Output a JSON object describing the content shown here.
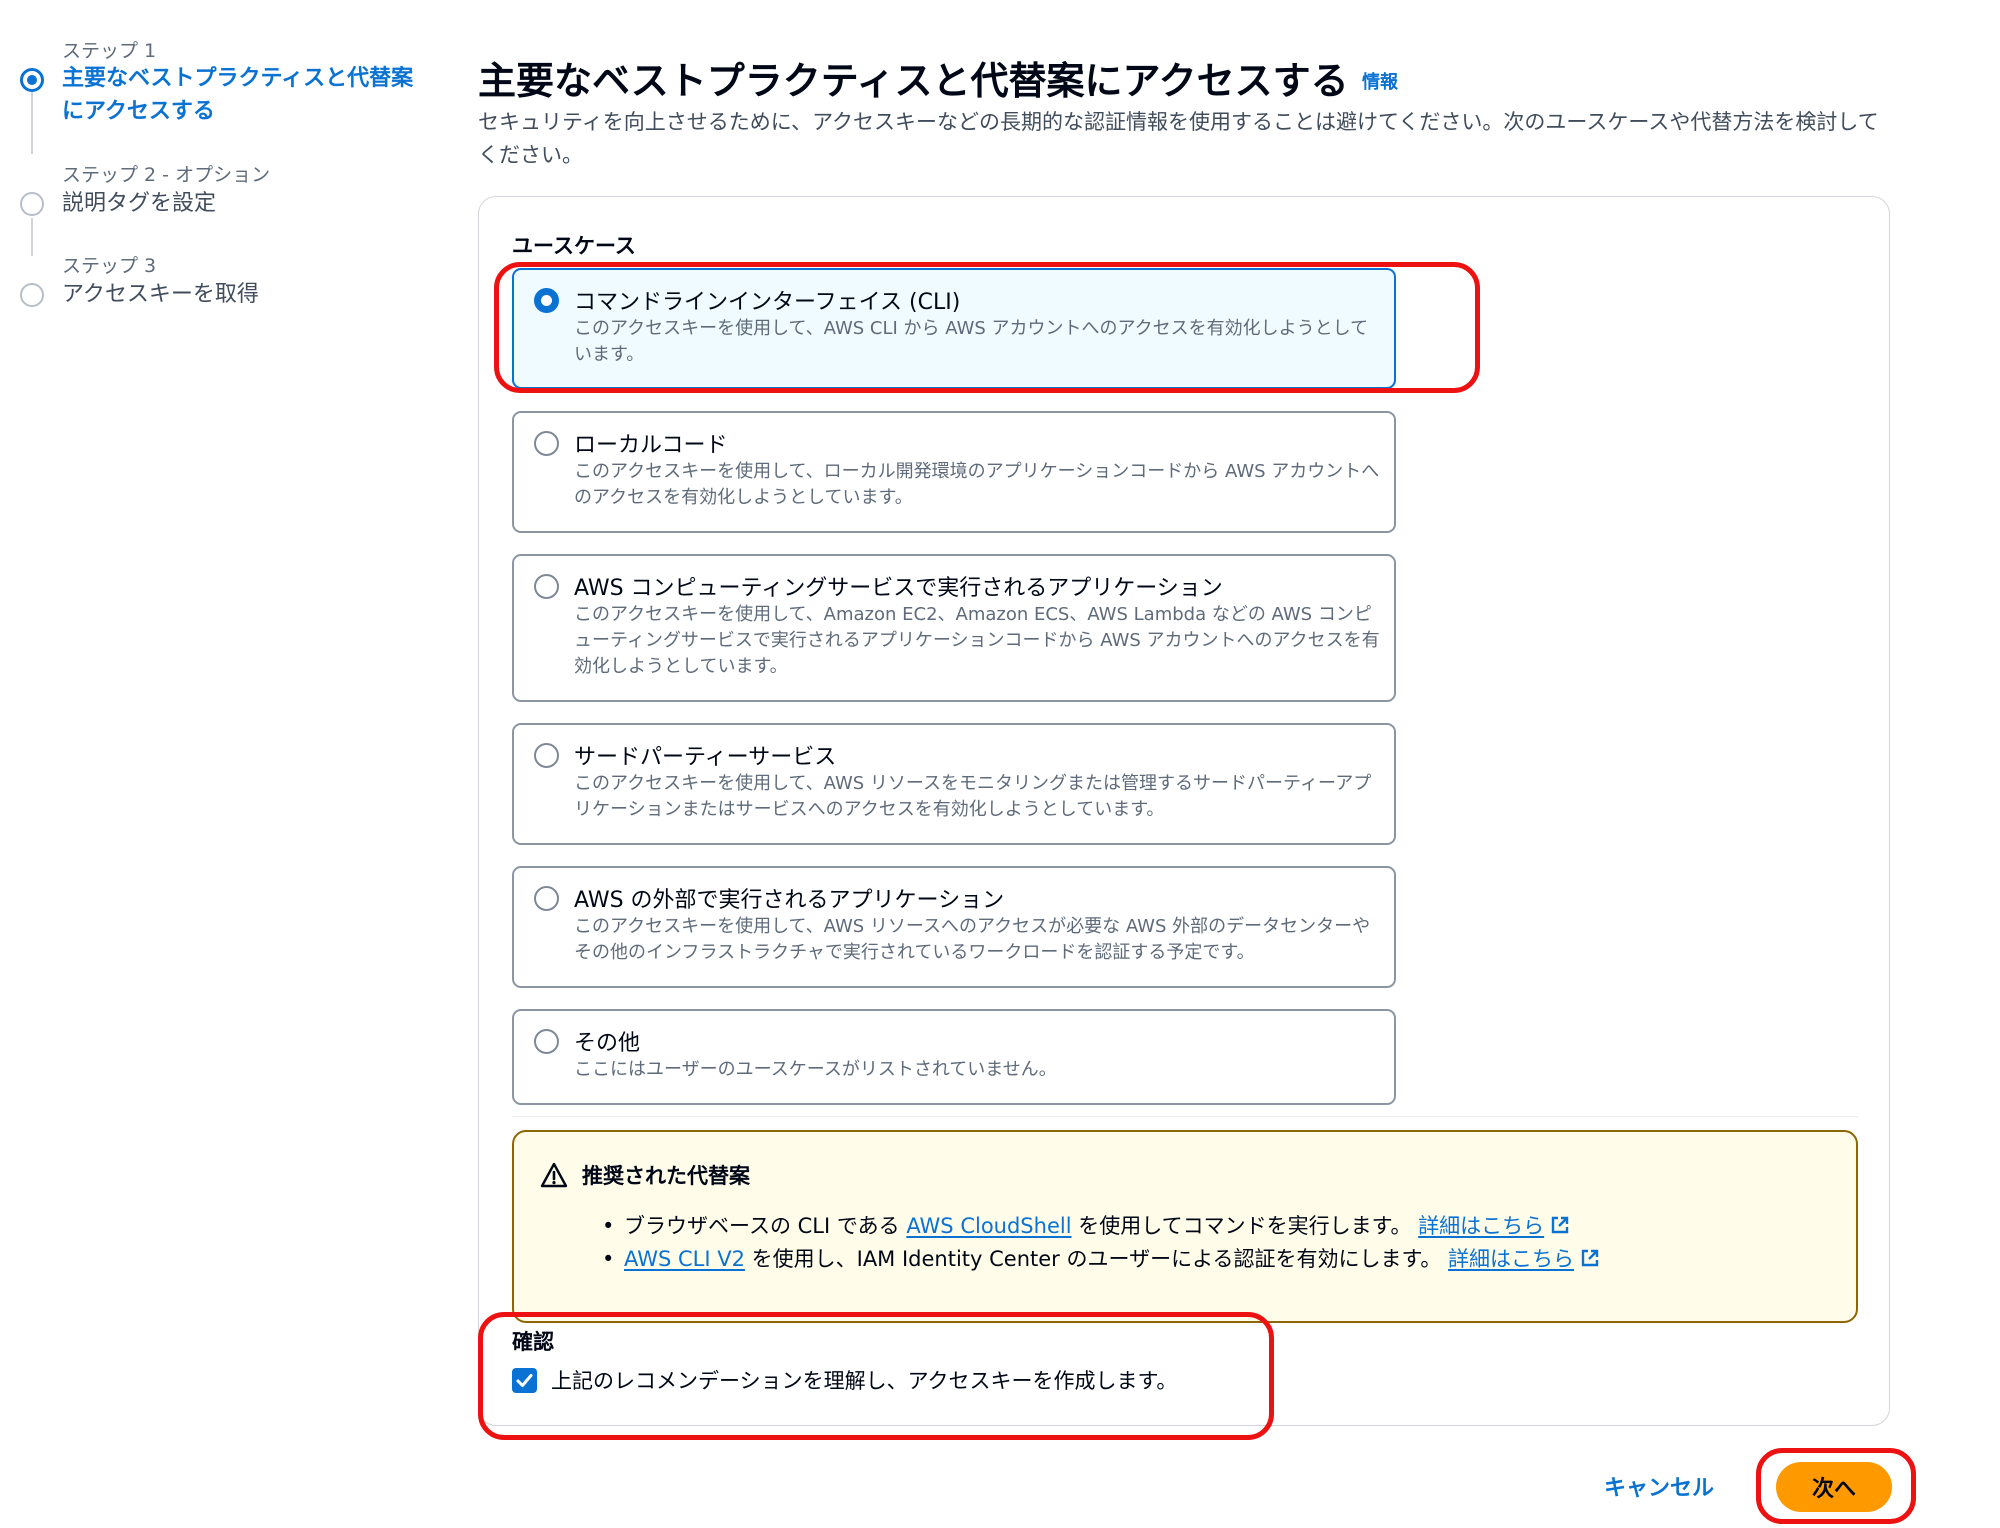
{
  "steps": [
    {
      "num": "ステップ 1",
      "title_line1": "主要なベストプラクティスと代替案",
      "title_line2": "にアクセスする",
      "active": true
    },
    {
      "num": "ステップ 2 - オプション",
      "title": "説明タグを設定",
      "active": false
    },
    {
      "num": "ステップ 3",
      "title": "アクセスキーを取得",
      "active": false
    }
  ],
  "header": {
    "title": "主要なベストプラクティスと代替案にアクセスする",
    "info": "情報",
    "description": "セキュリティを向上させるために、アクセスキーなどの長期的な認証情報を使用することは避けてください。次のユースケースや代替方法を検討してください。"
  },
  "use_cases": {
    "label": "ユースケース",
    "options": [
      {
        "title": "コマンドラインインターフェイス (CLI)",
        "description": "このアクセスキーを使用して、AWS CLI から AWS アカウントへのアクセスを有効化しようとしています。",
        "selected": true
      },
      {
        "title": "ローカルコード",
        "description": "このアクセスキーを使用して、ローカル開発環境のアプリケーションコードから AWS アカウントへのアクセスを有効化しようとしています。",
        "selected": false
      },
      {
        "title": "AWS コンピューティングサービスで実行されるアプリケーション",
        "description": "このアクセスキーを使用して、Amazon EC2、Amazon ECS、AWS Lambda などの AWS コンピューティングサービスで実行されるアプリケーションコードから AWS アカウントへのアクセスを有効化しようとしています。",
        "selected": false
      },
      {
        "title": "サードパーティーサービス",
        "description": "このアクセスキーを使用して、AWS リソースをモニタリングまたは管理するサードパーティーアプリケーションまたはサービスへのアクセスを有効化しようとしています。",
        "selected": false
      },
      {
        "title": "AWS の外部で実行されるアプリケーション",
        "description": "このアクセスキーを使用して、AWS リソースへのアクセスが必要な AWS 外部のデータセンターやその他のインフラストラクチャで実行されているワークロードを認証する予定です。",
        "selected": false
      },
      {
        "title": "その他",
        "description": "ここにはユーザーのユースケースがリストされていません。",
        "selected": false
      }
    ]
  },
  "alert": {
    "title": "推奨された代替案",
    "item1": {
      "before": "ブラウザベースの CLI である ",
      "link": "AWS CloudShell",
      "after": " を使用してコマンドを実行します。 ",
      "more": "詳細はこちら"
    },
    "item2": {
      "link": "AWS CLI V2",
      "after": " を使用し、IAM Identity Center のユーザーによる認証を有効にします。 ",
      "more": "詳細はこちら"
    }
  },
  "acknowledgement": {
    "label": "確認",
    "text": "上記のレコメンデーションを理解し、アクセスキーを作成します。",
    "checked": true
  },
  "buttons": {
    "cancel": "キャンセル",
    "next": "次へ"
  },
  "colors": {
    "accent": "#0972d3",
    "primary_button": "#ff9900",
    "warning_border": "#8d6605",
    "warning_bg": "#fffce9",
    "annotation": "#ee1111"
  }
}
